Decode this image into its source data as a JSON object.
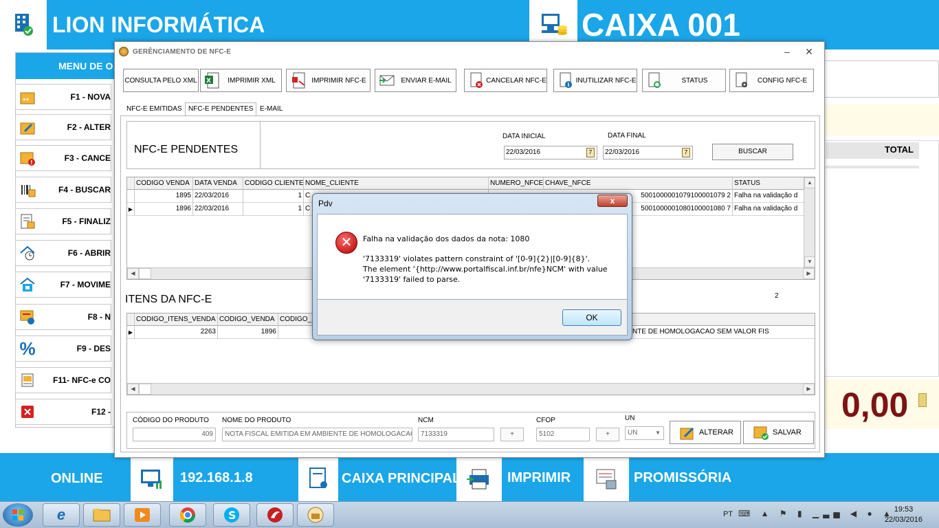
{
  "app": {
    "company_name": "LION INFORMÁTICA",
    "caixa_title": "CAIXA 001"
  },
  "side_menu": {
    "header": "MENU DE O",
    "items": [
      {
        "label": "F1 - NOVA",
        "icon": "new-sale-icon"
      },
      {
        "label": "F2 - ALTER",
        "icon": "edit-box-icon"
      },
      {
        "label": "F3 - CANCE",
        "icon": "cancel-box-icon"
      },
      {
        "label": "F4 - BUSCAR",
        "icon": "barcode-icon"
      },
      {
        "label": "F5 - FINALIZ",
        "icon": "finalize-icon"
      },
      {
        "label": "F6 - ABRIR",
        "icon": "house-clock-icon"
      },
      {
        "label": "F7 - MOVIME",
        "icon": "movement-icon"
      },
      {
        "label": "F8 - N",
        "icon": "nfe-globe-icon"
      },
      {
        "label": "F9 - DES",
        "icon": "percent-icon"
      },
      {
        "label": "F11- NFC-e CO",
        "icon": "nfce-icon"
      },
      {
        "label": "F12 -",
        "icon": "close-red-icon"
      }
    ]
  },
  "right_panel": {
    "total_label": "TOTAL",
    "total_value": "0,00"
  },
  "bottom_bar": {
    "status": "ONLINE",
    "ip": "192.168.1.8",
    "caixa": "CAIXA PRINCIPAL",
    "imprimir": "IMPRIMIR",
    "promissoria": "PROMISSÓRIA"
  },
  "window": {
    "title": "GERÊNCIAMENTO DE NFC-E",
    "toolbar": [
      {
        "label": "CONSULTA PELO XML",
        "icon": ""
      },
      {
        "label": "IMPRIMIR XML",
        "icon": "excel-xml-icon"
      },
      {
        "label": "IMPRIMIR NFC-E",
        "icon": "pdf-icon"
      },
      {
        "label": "ENVIAR E-MAIL",
        "icon": "email-send-icon"
      },
      {
        "label": "CANCELAR NFC-E",
        "icon": "cancel-doc-icon"
      },
      {
        "label": "INUTILIZAR NFC-E",
        "icon": "info-doc-icon"
      },
      {
        "label": "STATUS",
        "icon": "refresh-doc-icon"
      },
      {
        "label": "CONFIG NFC-E",
        "icon": "settings-doc-icon"
      }
    ],
    "tabs": [
      "NFC-E EMITIDAS",
      "NFC-E PENDENTES",
      "E-MAIL"
    ],
    "active_tab": "NFC-E PENDENTES",
    "filter": {
      "title": "NFC-E PENDENTES",
      "data_inicial_label": "DATA INICIAL",
      "data_inicial": "22/03/2016",
      "data_final_label": "DATA FINAL",
      "data_final": "22/03/2016",
      "buscar_label": "BUSCAR",
      "calendar_glyph": "7"
    },
    "nfce_grid": {
      "columns": [
        "CODIGO VENDA",
        "DATA VENDA",
        "CODIGO CLIENTE",
        "NOME_CLIENTE",
        "NUMERO_NFCE",
        "CHAVE_NFCE",
        "STATUS"
      ],
      "rows": [
        {
          "codigo_venda": "1895",
          "data_venda": "22/03/2016",
          "codigo_cliente": "1",
          "nome_cliente": "C",
          "chave": "5001000001079100001079 2",
          "status": "Falha na validação d"
        },
        {
          "codigo_venda": "1896",
          "data_venda": "22/03/2016",
          "codigo_cliente": "1",
          "nome_cliente": "C",
          "chave": "5001000001080100001080 7",
          "status": "Falha na validação d"
        }
      ]
    },
    "itens_title": "ITENS DA NFC-E",
    "itens_count": "2",
    "itens_grid": {
      "columns": [
        "CODIGO_ITENS_VENDA",
        "CODIGO_VENDA",
        "CODIGO_I"
      ],
      "rows": [
        {
          "codigo_itens_venda": "2263",
          "codigo_venda": "1896",
          "descricao_tail": "NTE DE HOMOLOGACAO SEM VALOR FIS"
        }
      ]
    },
    "produto": {
      "codigo_label": "CÓDIGO DO PRODUTO",
      "codigo_value": "409",
      "nome_label": "NOME DO PRODUTO",
      "nome_value": "NOTA FISCAL EMITIDA EM AMBIENTE DE HOMOLOGACAO",
      "ncm_label": "NCM",
      "ncm_value": "7133319",
      "cfop_label": "CFOP",
      "cfop_value": "5102",
      "un_label": "UN",
      "un_value": "UN",
      "plus": "+",
      "alterar_label": "ALTERAR",
      "salvar_label": "SALVAR"
    }
  },
  "dialog": {
    "title": "Pdv",
    "close_glyph": "x",
    "line1": "Falha na validação dos dados da nota: 1080",
    "line2": "'7133319' violates pattern constraint of '[0-9]{2}|[0-9]{8}'.",
    "line3": "The element '{http://www.portalfiscal.inf.br/nfe}NCM' with value",
    "line4": "'7133319' failed to parse.",
    "ok_label": "OK"
  },
  "taskbar": {
    "lang": "PT",
    "time": "19:53",
    "date": "22/03/2016"
  }
}
